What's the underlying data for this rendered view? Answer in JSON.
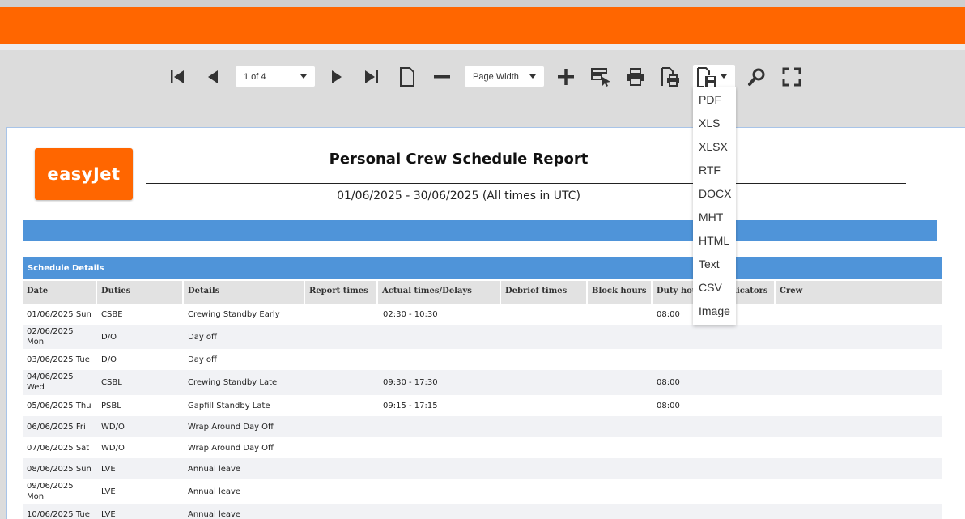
{
  "toolbar": {
    "page_selector": "1 of 4",
    "zoom_selector": "Page Width",
    "export_menu": [
      "PDF",
      "XLS",
      "XLSX",
      "RTF",
      "DOCX",
      "MHT",
      "HTML",
      "Text",
      "CSV",
      "Image"
    ]
  },
  "report": {
    "logo_text": "easyJet",
    "title": "Personal Crew Schedule Report",
    "subtitle": "01/06/2025 - 30/06/2025 (All times in UTC)",
    "section_title": "Schedule Details",
    "columns": [
      "Date",
      "Duties",
      "Details",
      "Report times",
      "Actual times/Delays",
      "Debrief times",
      "Block hours",
      "Duty hours",
      "Indicators",
      "Crew"
    ],
    "rows": [
      {
        "date_line1": "01/06/2025 Sun",
        "date_line2": "",
        "duties": "CSBE",
        "details": "Crewing Standby Early",
        "actual": "02:30 - 10:30",
        "duty_hours": "08:00"
      },
      {
        "date_line1": "02/06/2025",
        "date_line2": "Mon",
        "duties": "D/O",
        "details": "Day off",
        "actual": "",
        "duty_hours": ""
      },
      {
        "date_line1": "03/06/2025 Tue",
        "date_line2": "",
        "duties": "D/O",
        "details": "Day off",
        "actual": "",
        "duty_hours": ""
      },
      {
        "date_line1": "04/06/2025",
        "date_line2": "Wed",
        "duties": "CSBL",
        "details": "Crewing Standby Late",
        "actual": "09:30 - 17:30",
        "duty_hours": "08:00"
      },
      {
        "date_line1": "05/06/2025 Thu",
        "date_line2": "",
        "duties": "PSBL",
        "details": "Gapfill Standby Late",
        "actual": "09:15 - 17:15",
        "duty_hours": "08:00"
      },
      {
        "date_line1": "06/06/2025 Fri",
        "date_line2": "",
        "duties": "WD/O",
        "details": "Wrap Around Day Off",
        "actual": "",
        "duty_hours": ""
      },
      {
        "date_line1": "07/06/2025 Sat",
        "date_line2": "",
        "duties": "WD/O",
        "details": "Wrap Around Day Off",
        "actual": "",
        "duty_hours": ""
      },
      {
        "date_line1": "08/06/2025 Sun",
        "date_line2": "",
        "duties": "LVE",
        "details": "Annual leave",
        "actual": "",
        "duty_hours": ""
      },
      {
        "date_line1": "09/06/2025",
        "date_line2": "Mon",
        "duties": "LVE",
        "details": "Annual leave",
        "actual": "",
        "duty_hours": ""
      },
      {
        "date_line1": "10/06/2025 Tue",
        "date_line2": "",
        "duties": "LVE",
        "details": "Annual leave",
        "actual": "",
        "duty_hours": ""
      }
    ]
  },
  "colors": {
    "brand_orange": "#ff6600",
    "header_blue": "#4f94d9"
  }
}
